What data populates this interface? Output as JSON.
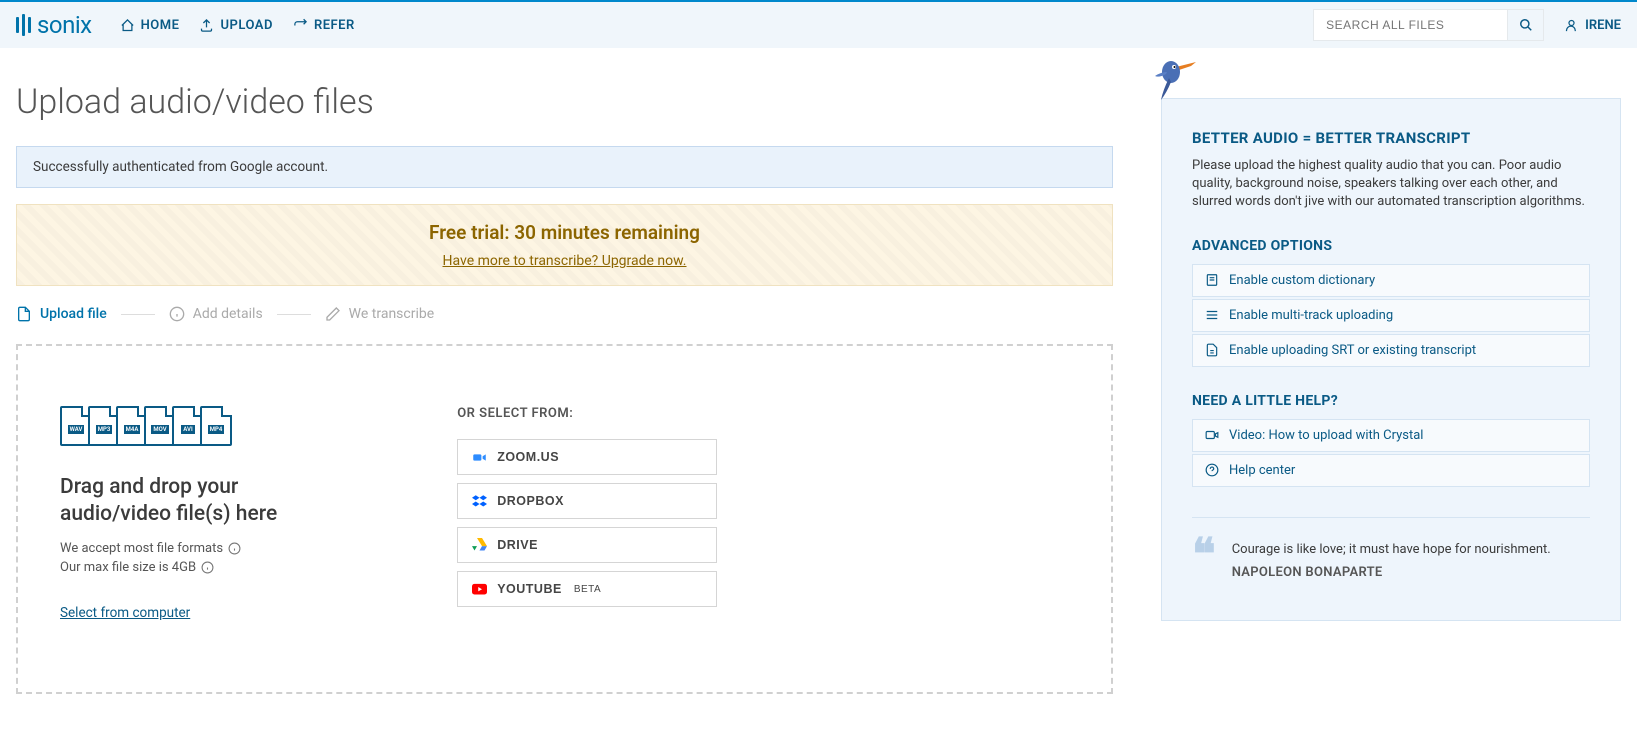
{
  "header": {
    "brand": "sonix",
    "nav": {
      "home": "HOME",
      "upload": "UPLOAD",
      "refer": "REFER"
    },
    "search_placeholder": "SEARCH ALL FILES",
    "user": "IRENE"
  },
  "page": {
    "title": "Upload audio/video files"
  },
  "alerts": {
    "auth_success": "Successfully authenticated from Google account.",
    "trial_title": "Free trial: 30 minutes remaining",
    "trial_link": "Have more to transcribe? Upgrade now."
  },
  "steps": {
    "upload": "Upload file",
    "details": "Add details",
    "transcribe": "We transcribe"
  },
  "drop": {
    "title_line1": "Drag and drop your",
    "title_line2": "audio/video file(s) here",
    "formats": "We accept most file formats",
    "maxsize": "Our max file size is 4GB",
    "select": "Select from computer",
    "or_label": "OR SELECT FROM:",
    "sources": {
      "zoom": "ZOOM.US",
      "dropbox": "DROPBOX",
      "drive": "DRIVE",
      "youtube": "YOUTUBE",
      "youtube_beta": "BETA"
    },
    "file_types": [
      "WAV",
      "MP3",
      "M4A",
      "MOV",
      "AVI",
      "MP4"
    ]
  },
  "sidebar": {
    "h1": "BETTER AUDIO = BETTER TRANSCRIPT",
    "p1": "Please upload the highest quality audio that you can. Poor audio quality, background noise, speakers talking over each other, and slurred words don't jive with our automated transcription algorithms.",
    "h2": "ADVANCED OPTIONS",
    "opts": {
      "dict": "Enable custom dictionary",
      "multi": "Enable multi-track uploading",
      "srt": "Enable uploading SRT or existing transcript"
    },
    "h3": "NEED A LITTLE HELP?",
    "help": {
      "video": "Video: How to upload with Crystal",
      "center": "Help center"
    },
    "quote": {
      "text": "Courage is like love; it must have hope for nourishment.",
      "author": "NAPOLEON BONAPARTE"
    }
  }
}
